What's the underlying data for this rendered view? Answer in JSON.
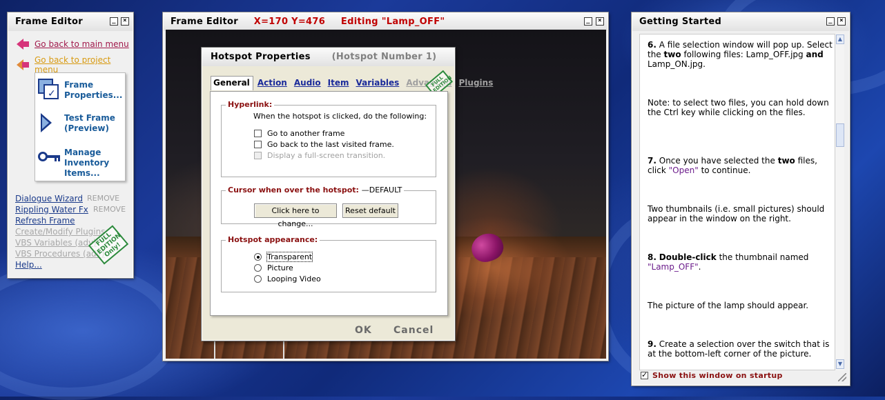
{
  "left_panel": {
    "title": "Frame Editor",
    "main_menu_link": "Go back to main menu",
    "project_menu_link": "Go back to project menu",
    "tools": [
      {
        "label": "Frame Properties..."
      },
      {
        "label": "Test Frame (Preview)"
      },
      {
        "label": "Manage Inventory Items..."
      }
    ],
    "links": [
      {
        "label": "Dialogue Wizard",
        "remove": "REMOVE"
      },
      {
        "label": "Rippling Water Fx",
        "remove": "REMOVE"
      },
      {
        "label": "Refresh Frame"
      },
      {
        "label": "Create/Modify Plugins"
      },
      {
        "label": "VBS Variables (adv)"
      },
      {
        "label": "VBS Procedures (adv)"
      },
      {
        "label": "Help..."
      }
    ],
    "stamp": "FULL EDITION Only!"
  },
  "frame_editor": {
    "title": "Frame Editor",
    "coords": "X=170 Y=476",
    "editing": "Editing \"Lamp_OFF\""
  },
  "hotspot": {
    "title": "Hotspot Properties",
    "subtitle": "(Hotspot Number 1)",
    "tabs": [
      "General",
      "Action",
      "Audio",
      "Item",
      "Variables",
      "Advanced",
      "Plugins"
    ],
    "stamp": "FULL EDITION",
    "hyperlink": {
      "legend": "Hyperlink:",
      "desc": "When the hotspot is clicked, do the following:",
      "options": [
        "Go to another frame",
        "Go back to the last visited frame.",
        "Display a full-screen transition."
      ]
    },
    "cursor": {
      "legend": "Cursor when over the hotspot:",
      "value": "DEFAULT",
      "change_btn": "Click here to change...",
      "reset_btn": "Reset default"
    },
    "appearance": {
      "legend": "Hotspot appearance:",
      "options": [
        "Transparent",
        "Picture",
        "Looping Video"
      ],
      "selected": "Transparent"
    },
    "ok": "OK",
    "cancel": "Cancel"
  },
  "getting_started": {
    "title": "Getting Started",
    "steps": {
      "s6_num": "6.",
      "s6_text": "A file selection window will pop up. Select the",
      "s6_bold": "two",
      "s6_text2": "following files: Lamp_OFF.jpg",
      "s6_and": "and",
      "s6_text3": "Lamp_ON.jpg.",
      "note": "Note: to select two files, you can hold down the Ctrl key while clicking on the files.",
      "s7_num": "7.",
      "s7_text": "Once you have selected the",
      "s7_bold": "two",
      "s7_text2": "files, click",
      "s7_open": "\"Open\"",
      "s7_text3": "to continue.",
      "thumbs": "Two thumbnails (i.e. small pictures) should appear in the window on the right.",
      "s8_num": "8.",
      "s8_bold": "Double-click",
      "s8_text": "the thumbnail named",
      "s8_name": "\"Lamp_OFF\"",
      "s8_end": ".",
      "lamp": "The picture of the lamp should appear.",
      "s9_num": "9.",
      "s9_text": "Create a selection over the switch that is at the bottom-left corner of the picture."
    },
    "startup_label": "Show this window on startup",
    "startup_checked": true
  }
}
